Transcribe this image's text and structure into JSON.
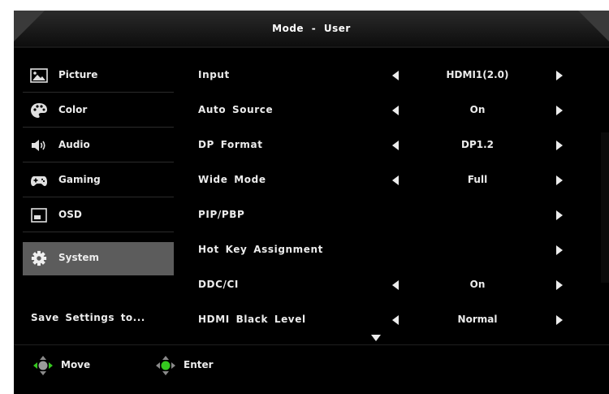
{
  "header": {
    "title": "Mode - User"
  },
  "sidebar": {
    "items": [
      {
        "label": "Picture",
        "icon": "picture-icon",
        "active": false
      },
      {
        "label": "Color",
        "icon": "palette-icon",
        "active": false
      },
      {
        "label": "Audio",
        "icon": "speaker-icon",
        "active": false
      },
      {
        "label": "Gaming",
        "icon": "gamepad-icon",
        "active": false
      },
      {
        "label": "OSD",
        "icon": "osd-icon",
        "active": false
      },
      {
        "label": "System",
        "icon": "gear-icon",
        "active": true
      }
    ],
    "save_settings": "Save Settings to..."
  },
  "settings": {
    "rows": [
      {
        "label": "Input",
        "value": "HDMI1(2.0)"
      },
      {
        "label": "Auto Source",
        "value": "On"
      },
      {
        "label": "DP Format",
        "value": "DP1.2"
      },
      {
        "label": "Wide Mode",
        "value": "Full"
      },
      {
        "label": "PIP/PBP",
        "value": ""
      },
      {
        "label": "Hot Key Assignment",
        "value": ""
      },
      {
        "label": "DDC/CI",
        "value": "On"
      },
      {
        "label": "HDMI Black Level",
        "value": "Normal"
      }
    ]
  },
  "footer": {
    "move_label": "Move",
    "enter_label": "Enter"
  },
  "colors": {
    "active_item": "#5c5c5c",
    "nav_green": "#35c81f",
    "background": "#000000"
  }
}
